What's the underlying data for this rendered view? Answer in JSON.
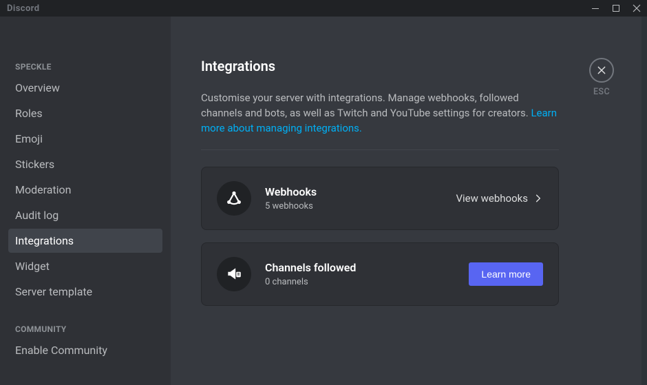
{
  "titlebar": {
    "brand": "Discord"
  },
  "sidebar": {
    "section1_header": "SPECKLE",
    "items1": [
      {
        "label": "Overview"
      },
      {
        "label": "Roles"
      },
      {
        "label": "Emoji"
      },
      {
        "label": "Stickers"
      },
      {
        "label": "Moderation"
      },
      {
        "label": "Audit log"
      },
      {
        "label": "Integrations"
      },
      {
        "label": "Widget"
      },
      {
        "label": "Server template"
      }
    ],
    "section2_header": "COMMUNITY",
    "items2": [
      {
        "label": "Enable Community"
      }
    ]
  },
  "page": {
    "title": "Integrations",
    "desc_text": "Customise your server with integrations. Manage webhooks, followed channels and bots, as well as Twitch and YouTube settings for creators. ",
    "desc_link": "Learn more about managing integrations."
  },
  "cards": {
    "webhooks": {
      "title": "Webhooks",
      "sub": "5 webhooks",
      "action": "View webhooks"
    },
    "channels": {
      "title": "Channels followed",
      "sub": "0 channels",
      "action": "Learn more"
    }
  },
  "close": {
    "label": "ESC"
  }
}
